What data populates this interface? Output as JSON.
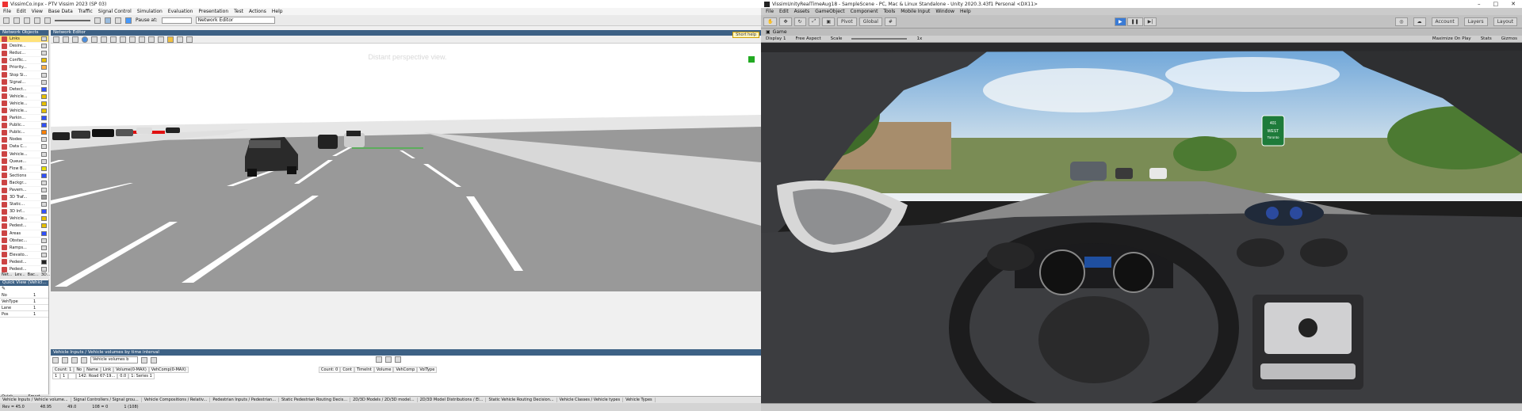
{
  "vissim": {
    "title": "VissimCo.inpx - PTV Vissim 2023 (SP 03)",
    "menu": [
      "File",
      "Edit",
      "View",
      "Base Data",
      "Traffic",
      "Signal Control",
      "Simulation",
      "Evaluation",
      "Presentation",
      "Test",
      "Actions",
      "Help"
    ],
    "toolbar": {
      "pause_label": "Pause at:",
      "view_select": "Network Editor"
    },
    "network_objects_title": "Network Objects",
    "network_items": [
      {
        "label": "Links",
        "color": "#d9d9d9",
        "selected": true
      },
      {
        "label": "Desire...",
        "color": "#d9d9d9"
      },
      {
        "label": "Reduc...",
        "color": "#d9d9d9"
      },
      {
        "label": "Conflic...",
        "color": "#e6c000"
      },
      {
        "label": "Priority...",
        "color": "#ffb040"
      },
      {
        "label": "Stop Si...",
        "color": "#d9d9d9"
      },
      {
        "label": "Signal...",
        "color": "#d9d9d9"
      },
      {
        "label": "Detect...",
        "color": "#3050ff"
      },
      {
        "label": "Vehicle...",
        "color": "#e6c000"
      },
      {
        "label": "Vehicle...",
        "color": "#e6c000"
      },
      {
        "label": "Vehicle...",
        "color": "#e6c000"
      },
      {
        "label": "Parkin...",
        "color": "#3050ff"
      },
      {
        "label": "Public...",
        "color": "#3050ff"
      },
      {
        "label": "Public...",
        "color": "#ff8000"
      },
      {
        "label": "Nodes",
        "color": "#d9d9d9"
      },
      {
        "label": "Data C...",
        "color": "#d9d9d9"
      },
      {
        "label": "Vehicle...",
        "color": "#d9d9d9"
      },
      {
        "label": "Queue...",
        "color": "#d9d9d9"
      },
      {
        "label": "Flow B...",
        "color": "#e6e000"
      },
      {
        "label": "Sections",
        "color": "#3050ff"
      },
      {
        "label": "Backgr...",
        "color": "#d9d9d9"
      },
      {
        "label": "Pavem...",
        "color": "#d9d9d9"
      },
      {
        "label": "3D Traf...",
        "color": "#999999"
      },
      {
        "label": "Static...",
        "color": "#d9d9d9"
      },
      {
        "label": "3D Inf...",
        "color": "#3050ff"
      },
      {
        "label": "Vehicle...",
        "color": "#e6c000"
      },
      {
        "label": "Pedest...",
        "color": "#e6c000"
      },
      {
        "label": "Areas",
        "color": "#3050ff"
      },
      {
        "label": "Obstac...",
        "color": "#d9d9d9"
      },
      {
        "label": "Ramps...",
        "color": "#d9d9d9"
      },
      {
        "label": "Elevato...",
        "color": "#d9d9d9"
      },
      {
        "label": "Pedest...",
        "color": "#222222"
      },
      {
        "label": "Pedest...",
        "color": "#d9d9d9"
      }
    ],
    "network_tabs": [
      "Net...",
      "Lev...",
      "Bac...",
      "3D..."
    ],
    "quick_view_title": "Quick View (Vehicl...",
    "quick_rows": [
      {
        "k": "No",
        "v": "1"
      },
      {
        "k": "VehType",
        "v": "1"
      },
      {
        "k": "Lane",
        "v": "1"
      },
      {
        "k": "Pos",
        "v": "1"
      }
    ],
    "quick_tabs": [
      "Quick Vie...",
      "Smart Map"
    ],
    "network_editor_title": "Network Editor",
    "short_help": "Short help",
    "watermark": "Distant perspective view.",
    "bottom_title": "Vehicle Inputs / Vehicle volumes by time interval",
    "bottom_select": "Vehicle volumes b",
    "left_headers": [
      "Count: 1",
      "No",
      "Name",
      "Link",
      "Volume(0-MAX)",
      "VehComp(0-MAX)"
    ],
    "left_row": [
      "1",
      "1",
      "",
      "142: Road 67-19...",
      "0.0",
      "1: Series 1"
    ],
    "right_headers": [
      "Count: 0",
      "Cont",
      "TimeInt",
      "Volume",
      "VehComp",
      "VolType"
    ],
    "tabs": [
      "Vehicle Inputs / Vehicle volume...",
      "Signal Controllers / Signal grou...",
      "Vehicle Compositions / Relativ...",
      "Pedestrian Inputs / Pedestrian...",
      "Static Pedestrian Routing Decis...",
      "2D/3D Models / 2D/3D model...",
      "2D/3D Model Distributions / El...",
      "Static Vehicle Routing Decision...",
      "Vehicle Classes / Vehicle types",
      "Vehicle Types"
    ],
    "status": [
      "Rev = 45.0",
      "48.95",
      "49.0",
      "108 = 0",
      "1 (108)"
    ]
  },
  "unity": {
    "title": "VissimUnityRealTimeAug18 - SampleScene - PC, Mac & Linux Standalone - Unity 2020.3.43f1 Personal <DX11>",
    "menu": [
      "File",
      "Edit",
      "Assets",
      "GameObject",
      "Component",
      "Tools",
      "Mobile Input",
      "Window",
      "Help"
    ],
    "toolbar": {
      "pivot": "Pivot",
      "global": "Global",
      "account": "Account",
      "layers": "Layers",
      "layout": "Layout"
    },
    "game_tab": "Game",
    "game_bar": {
      "display": "Display 1",
      "aspect": "Free Aspect",
      "scale": "Scale",
      "scale_value": "1x",
      "maximize": "Maximize On Play",
      "stats": "Stats",
      "gizmos": "Gizmos"
    },
    "sign": {
      "route": "401",
      "line1": "WEST",
      "line2": "Toronto"
    }
  }
}
